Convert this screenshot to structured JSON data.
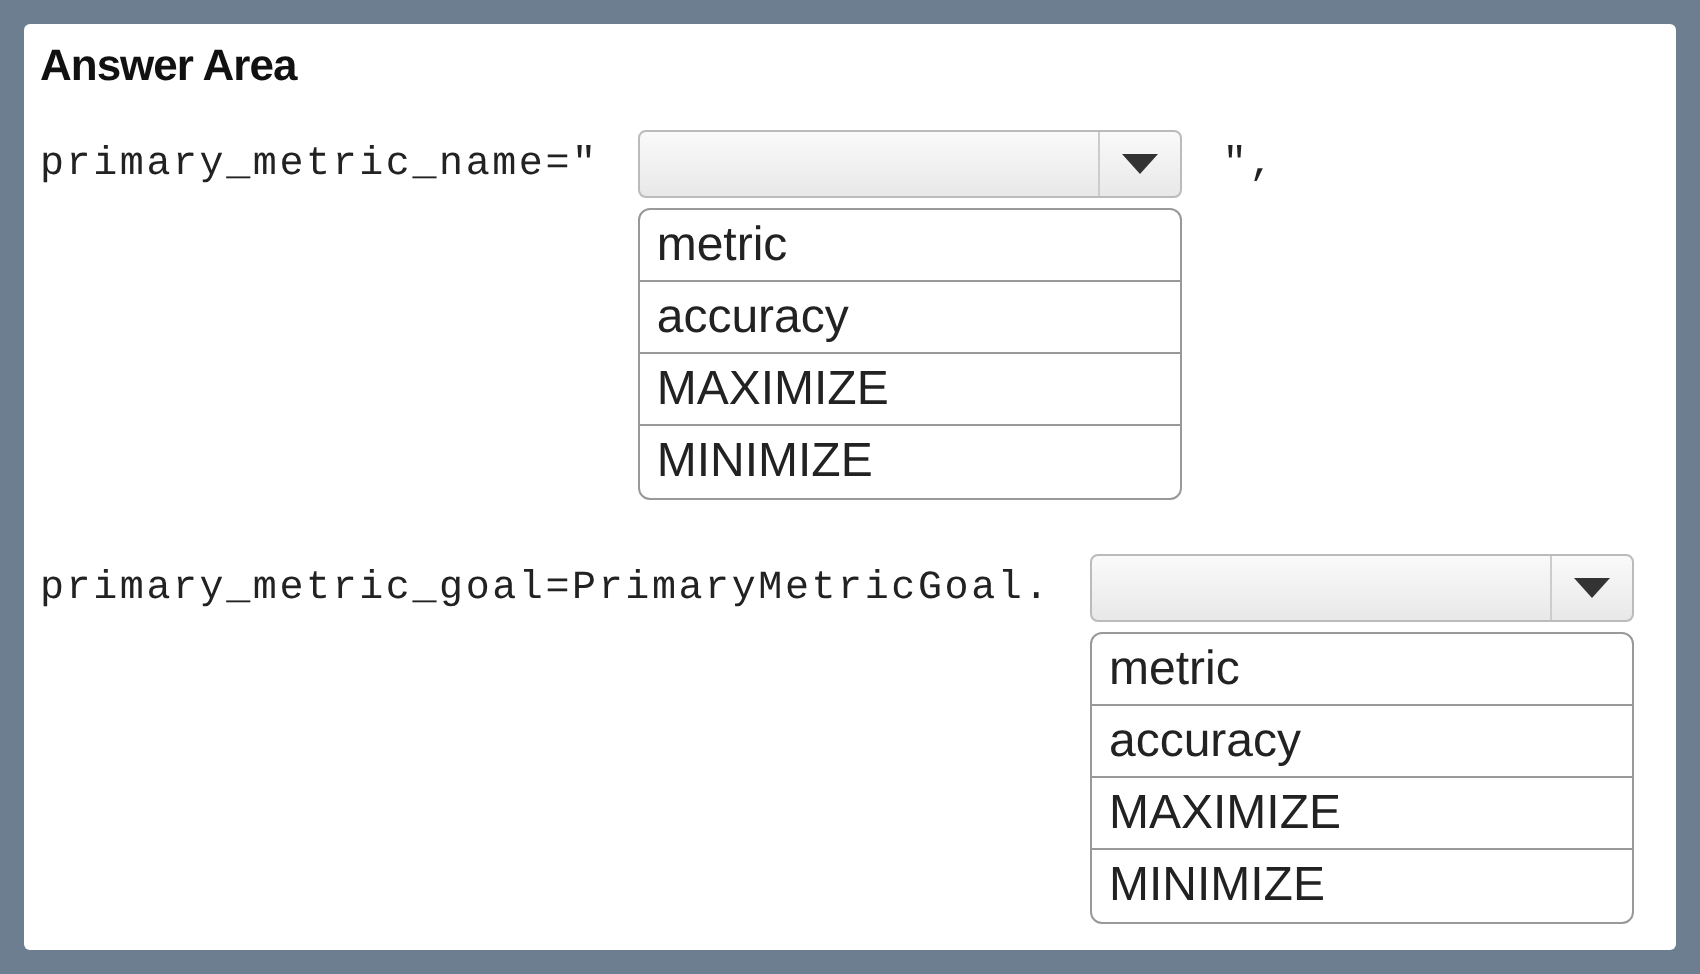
{
  "title": "Answer Area",
  "questions": [
    {
      "prefix": "primary_metric_name=\"",
      "suffix": "\",",
      "options": [
        "metric",
        "accuracy",
        "MAXIMIZE",
        "MINIMIZE"
      ]
    },
    {
      "prefix": "primary_metric_goal=PrimaryMetricGoal.",
      "options": [
        "metric",
        "accuracy",
        "MAXIMIZE",
        "MINIMIZE"
      ]
    }
  ]
}
